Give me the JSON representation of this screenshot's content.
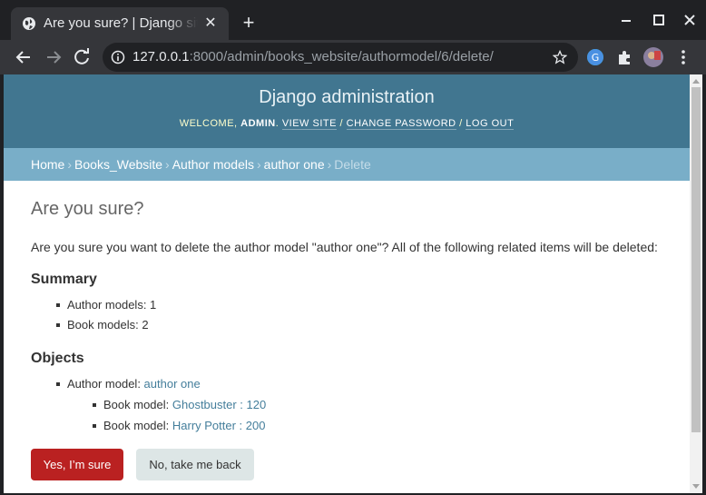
{
  "browser": {
    "tab_title": "Are you sure? | Django site admin",
    "url_host": "127.0.0.1",
    "url_rest": ":8000/admin/books_website/authormodel/6/delete/"
  },
  "header": {
    "site_name": "Django administration",
    "welcome": "WELCOME, ",
    "username": "ADMIN",
    "view_site": "VIEW SITE",
    "change_password": "CHANGE PASSWORD",
    "log_out": "LOG OUT"
  },
  "breadcrumbs": {
    "items": [
      "Home",
      "Books_Website",
      "Author models",
      "author one"
    ],
    "current": "Delete"
  },
  "main": {
    "title": "Are you sure?",
    "question": "Are you sure you want to delete the author model \"author one\"? All of the following related items will be deleted:",
    "summary_heading": "Summary",
    "summary": [
      "Author models: 1",
      "Book models: 2"
    ],
    "objects_heading": "Objects",
    "author_label": "Author model: ",
    "author_link": "author one",
    "books": [
      {
        "label": "Book model: ",
        "link": "Ghostbuster : 120"
      },
      {
        "label": "Book model: ",
        "link": "Harry Potter : 200"
      }
    ],
    "confirm_button": "Yes, I’m sure",
    "cancel_button": "No, take me back"
  },
  "colors": {
    "header": "#417690",
    "breadcrumbs": "#79aec8",
    "danger": "#ba2121",
    "link": "#447e9b"
  }
}
